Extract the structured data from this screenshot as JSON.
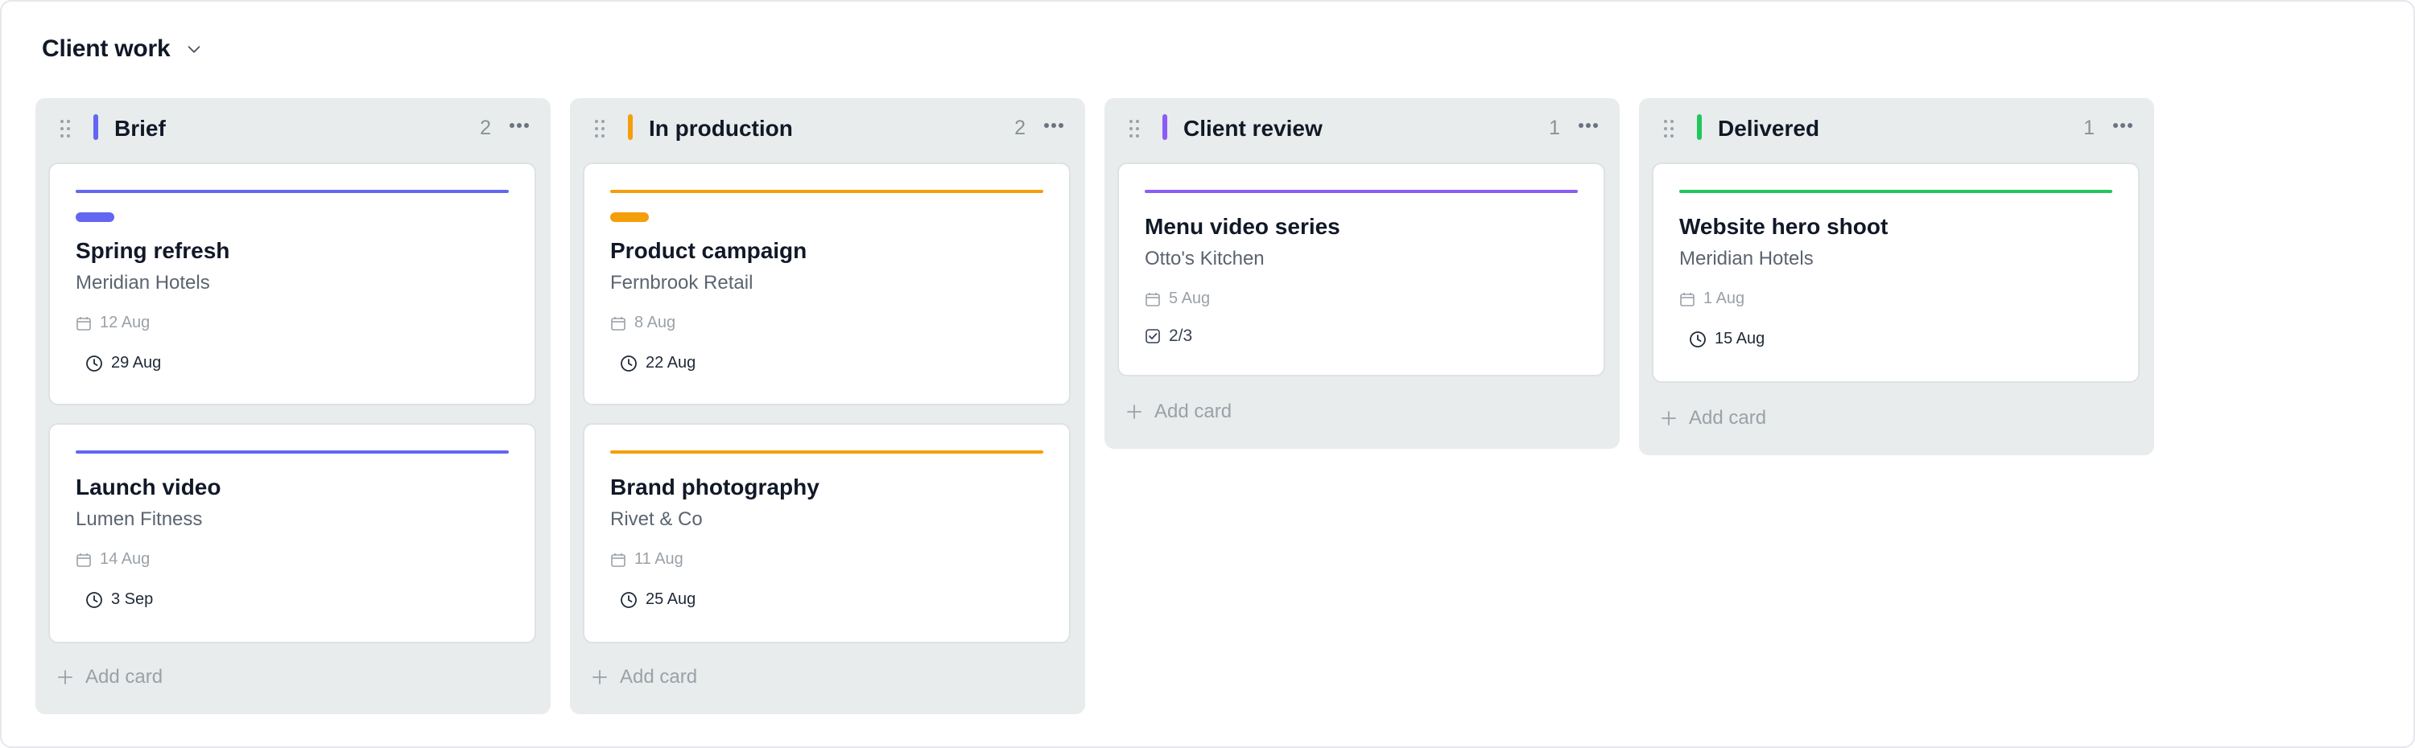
{
  "board": {
    "title": "Client work"
  },
  "columns": [
    {
      "title": "Brief",
      "count": "2",
      "color": "#6366f1",
      "add_label": "Add card",
      "cards": [
        {
          "title": "Spring refresh",
          "client": "Meridian Hotels",
          "start": "12 Aug",
          "due": "29 Aug",
          "tag": true
        },
        {
          "title": "Launch video",
          "client": "Lumen Fitness",
          "start": "14 Aug",
          "due": "3 Sep",
          "tag": false
        }
      ]
    },
    {
      "title": "In production",
      "count": "2",
      "color": "#f59e0b",
      "add_label": "Add card",
      "cards": [
        {
          "title": "Product campaign",
          "client": "Fernbrook Retail",
          "start": "8 Aug",
          "due": "22 Aug",
          "tag": true
        },
        {
          "title": "Brand photography",
          "client": "Rivet & Co",
          "start": "11 Aug",
          "due": "25 Aug",
          "tag": false
        }
      ]
    },
    {
      "title": "Client review",
      "count": "1",
      "color": "#8b5cf6",
      "add_label": "Add card",
      "cards": [
        {
          "title": "Menu video series",
          "client": "Otto's Kitchen",
          "start": "5 Aug",
          "checklist": "2/3"
        }
      ]
    },
    {
      "title": "Delivered",
      "count": "1",
      "color": "#22c55e",
      "add_label": "Add card",
      "cards": [
        {
          "title": "Website hero shoot",
          "client": "Meridian Hotels",
          "start": "1 Aug",
          "due": "15 Aug"
        }
      ]
    }
  ]
}
